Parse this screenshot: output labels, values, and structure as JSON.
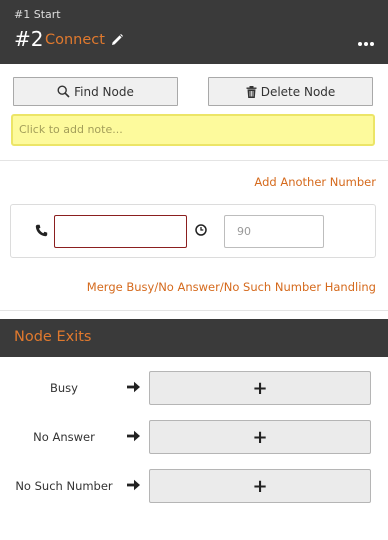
{
  "header": {
    "breadcrumb": "#1 Start",
    "node_number": "#2",
    "node_name": "Connect"
  },
  "toolbar": {
    "find_label": "Find Node",
    "delete_label": "Delete Node"
  },
  "note": {
    "placeholder": "Click to add note..."
  },
  "numbers": {
    "add_link": "Add Another Number",
    "phone_value": "",
    "timeout_placeholder": "90",
    "merge_link": "Merge Busy/No Answer/No Such Number Handling"
  },
  "exits": {
    "title": "Node Exits",
    "items": [
      {
        "label": "Busy",
        "button": "+"
      },
      {
        "label": "No Answer",
        "button": "+"
      },
      {
        "label": "No Such Number",
        "button": "+"
      }
    ]
  },
  "colors": {
    "accent": "#e0792e",
    "header_bg": "#3a3a3a",
    "note_bg": "#fdfa9c"
  }
}
